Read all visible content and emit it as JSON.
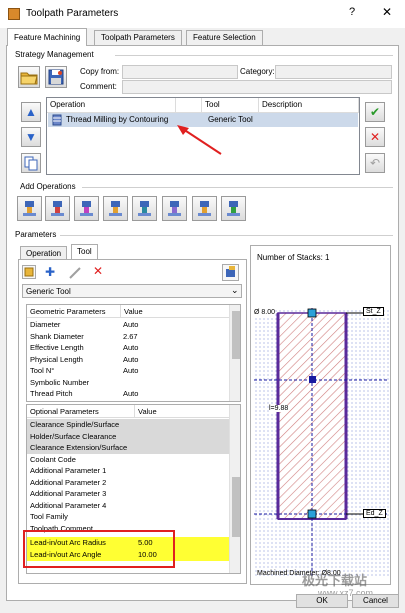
{
  "window": {
    "title": "Toolpath Parameters",
    "help": "?",
    "close": "✕"
  },
  "tabs": [
    "Feature Machining",
    "Toolpath Parameters",
    "Feature Selection"
  ],
  "strategy": {
    "group_title": "Strategy Management",
    "copy_from_label": "Copy from:",
    "category_label": "Category:",
    "comment_label": "Comment:",
    "columns": [
      "Operation",
      "Tool",
      "Description"
    ],
    "operation": {
      "name": "Thread Milling by Contouring",
      "tool": "Generic Tool",
      "description": ""
    }
  },
  "add_operations": {
    "group_title": "Add Operations"
  },
  "parameters": {
    "group_title": "Parameters",
    "subtabs": [
      "Operation",
      "Tool"
    ],
    "tool_select": "Generic Tool",
    "geometric": {
      "headers": [
        "Geometric Parameters",
        "Value"
      ],
      "rows": [
        [
          "Diameter",
          "Auto"
        ],
        [
          "Shank Diameter",
          "2.67"
        ],
        [
          "Effective Length",
          "Auto"
        ],
        [
          "Physical Length",
          "Auto"
        ],
        [
          "Tool N°",
          "Auto"
        ],
        [
          "Symbolic Number",
          ""
        ],
        [
          "Thread Pitch",
          "Auto"
        ]
      ]
    },
    "optional": {
      "headers": [
        "Optional Parameters",
        "Value"
      ],
      "rows": [
        [
          "Clearance Spindle/Surface",
          ""
        ],
        [
          "Holder/Surface Clearance",
          ""
        ],
        [
          "Clearance Extension/Surface",
          ""
        ],
        [
          "Coolant Code",
          ""
        ],
        [
          "Additional Parameter 1",
          ""
        ],
        [
          "Additional Parameter 2",
          ""
        ],
        [
          "Additional Parameter 3",
          ""
        ],
        [
          "Additional Parameter 4",
          ""
        ],
        [
          "Tool Family",
          ""
        ],
        [
          "Toolpath Comment",
          ""
        ],
        [
          "Lead-in/out Arc Radius",
          "5.00"
        ],
        [
          "Lead-in/out Arc Angle",
          "10.00"
        ]
      ]
    }
  },
  "preview": {
    "stacks": "Number of Stacks: 1",
    "diameter": "Ø 8.00",
    "length": "l=9.88",
    "top_label": "St_Z",
    "bottom_label": "Ed_Z",
    "machined_diameter": "Machined Diameter: Ø8.00"
  },
  "buttons": {
    "ok": "OK",
    "cancel": "Cancel"
  },
  "watermark": {
    "text": "极光下载站",
    "url": "www.xz7.com"
  },
  "colors": {
    "highlight": "#ffff00",
    "annotation": "#e02020",
    "selection": "#ccd9ea",
    "accent": "#1060c0"
  }
}
